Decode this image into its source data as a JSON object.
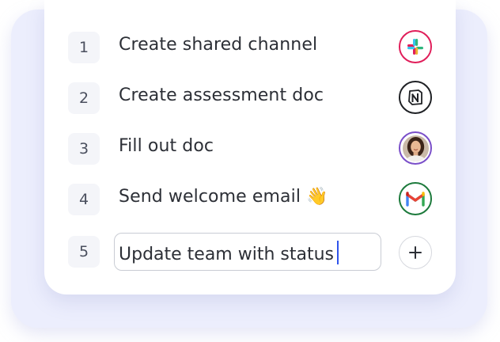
{
  "tasks": [
    {
      "number": "1",
      "label": "Create shared channel",
      "app_icon": "slack-icon"
    },
    {
      "number": "2",
      "label": "Create assessment doc",
      "app_icon": "notion-icon"
    },
    {
      "number": "3",
      "label": "Fill out doc",
      "app_icon": "user-avatar"
    },
    {
      "number": "4",
      "label": "Send welcome email 👋",
      "app_icon": "gmail-icon"
    }
  ],
  "new_task": {
    "number": "5",
    "value": "Update team with status",
    "add_icon": "plus-icon"
  },
  "colors": {
    "slack_ring": "#e01e5a",
    "notion_ring": "#1f2125",
    "avatar_ring": "#7a4fc9",
    "gmail_ring": "#1d7a3c",
    "caret": "#2f54eb",
    "number_bg": "#f4f5f9"
  }
}
